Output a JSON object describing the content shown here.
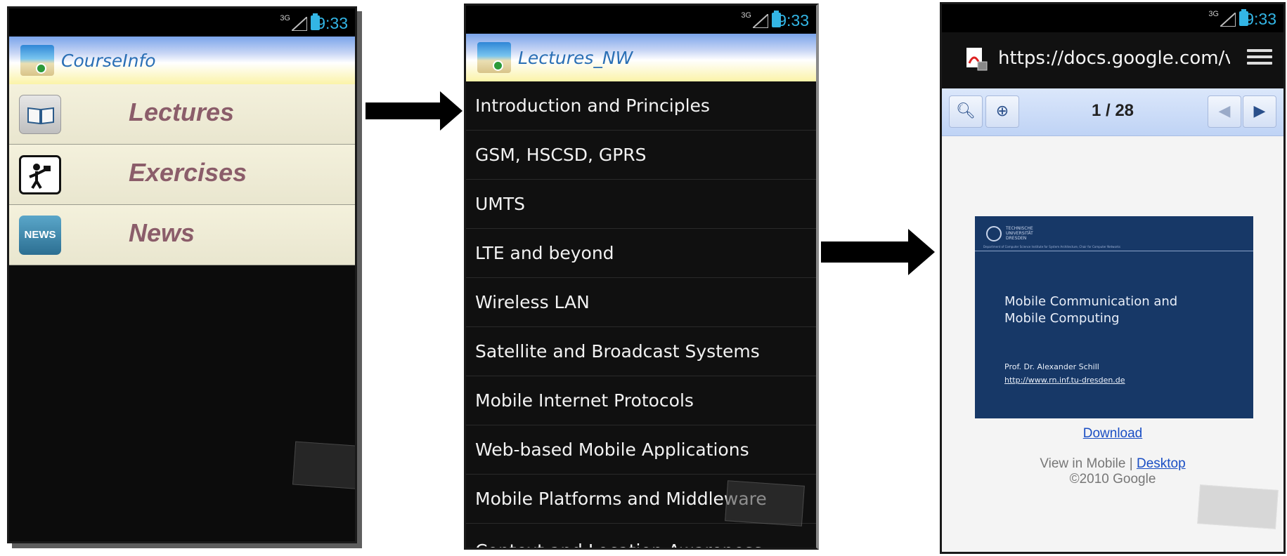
{
  "status_bar": {
    "network": "3G",
    "time": "9:33"
  },
  "screen1": {
    "title": "CourseInfo",
    "menu": [
      {
        "label": "Lectures",
        "icon": "book-icon"
      },
      {
        "label": "Exercises",
        "icon": "exercise-icon"
      },
      {
        "label": "News",
        "icon": "news-icon",
        "icon_text": "NEWS"
      }
    ]
  },
  "screen2": {
    "title": "Lectures_NW",
    "items": [
      "Introduction and Principles",
      "GSM, HSCSD, GPRS",
      "UMTS",
      "LTE and beyond",
      "Wireless LAN",
      "Satellite and Broadcast Systems",
      "Mobile Internet Protocols",
      "Web-based Mobile Applications",
      "Mobile Platforms and Middleware",
      "Context and Location Awareness"
    ]
  },
  "screen3": {
    "url": "https://docs.google.com/viewer",
    "page_indicator": "1 / 28",
    "slide": {
      "university": "TECHNISCHE\nUNIVERSITÄT\nDRESDEN",
      "department": "Department of Computer Science  Institute for System Architecture, Chair for Computer Networks",
      "title_line1": "Mobile Communication and",
      "title_line2": "Mobile Computing",
      "author": "Prof. Dr. Alexander Schill",
      "link": "http://www.rn.inf.tu-dresden.de"
    },
    "download_label": "Download",
    "view_in": "View in Mobile | ",
    "desktop_label": "Desktop",
    "copyright": "©2010 Google"
  }
}
